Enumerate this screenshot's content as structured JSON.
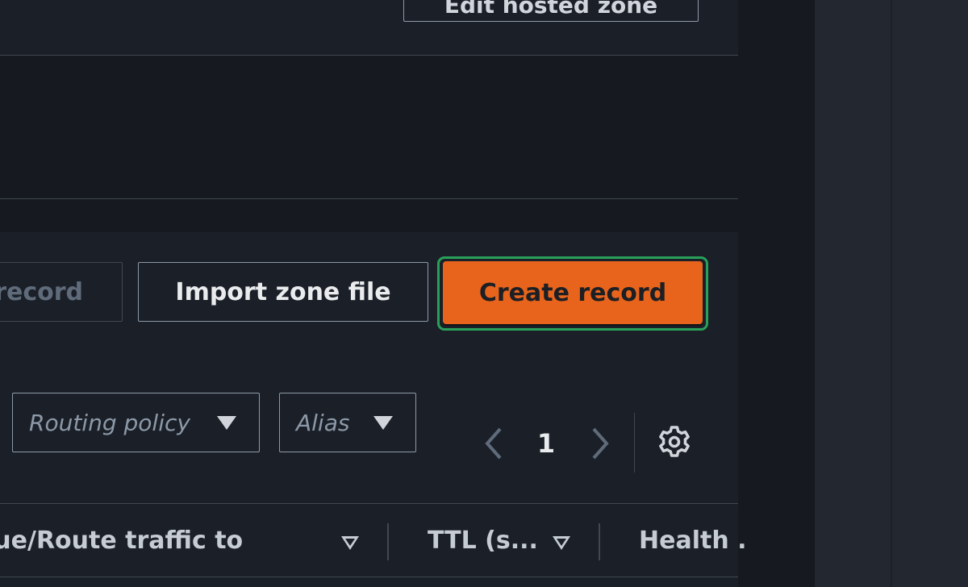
{
  "header": {
    "edit_button_label": "Edit hosted zone"
  },
  "toolbar": {
    "delete_label": "record",
    "import_label": "Import zone file",
    "create_label": "Create record"
  },
  "filters": {
    "routing_placeholder": "Routing policy",
    "alias_placeholder": "Alias"
  },
  "pagination": {
    "page": "1"
  },
  "table": {
    "columns": [
      "lue/Route traffic to",
      "TTL (s...",
      "Health ."
    ]
  },
  "icons": {
    "prev": "chevron-left-icon",
    "next": "chevron-right-icon",
    "settings": "gear-icon",
    "dropdown": "caret-down-icon",
    "sort": "sort-caret-icon"
  },
  "colors": {
    "primary_button": "#e8641c",
    "focus_ring": "#29a05a",
    "panel": "#1b2028",
    "background": "#16191f"
  }
}
